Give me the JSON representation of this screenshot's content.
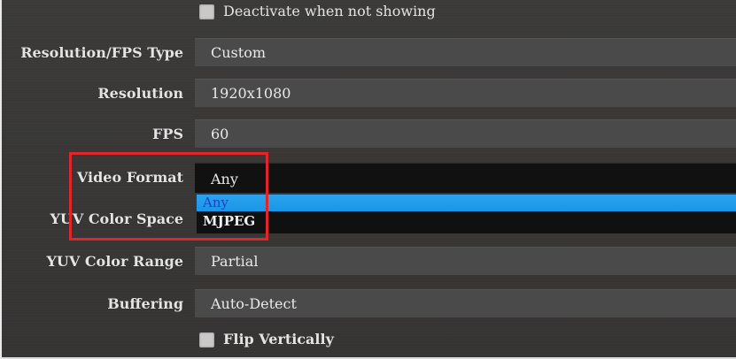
{
  "options": {
    "deactivate_checkbox_label": "Deactivate when not showing",
    "flip_checkbox_label": "Flip Vertically",
    "rows": [
      {
        "label": "Resolution/FPS Type",
        "value": "Custom"
      },
      {
        "label": "Resolution",
        "value": "1920x1080"
      },
      {
        "label": "FPS",
        "value": "60"
      },
      {
        "label": "Video Format",
        "value": "Any"
      },
      {
        "label": "YUV Color Space",
        "value": ""
      },
      {
        "label": "YUV Color Range",
        "value": "Partial"
      },
      {
        "label": "Buffering",
        "value": "Auto-Detect"
      }
    ]
  },
  "dropdown": {
    "options": [
      "Any",
      "MJPEG"
    ],
    "selected": "Any"
  },
  "colors": {
    "selection": "#1b95e6",
    "highlight_box": "#e0262b",
    "background": "#383736",
    "field": "#4b4a4a"
  }
}
